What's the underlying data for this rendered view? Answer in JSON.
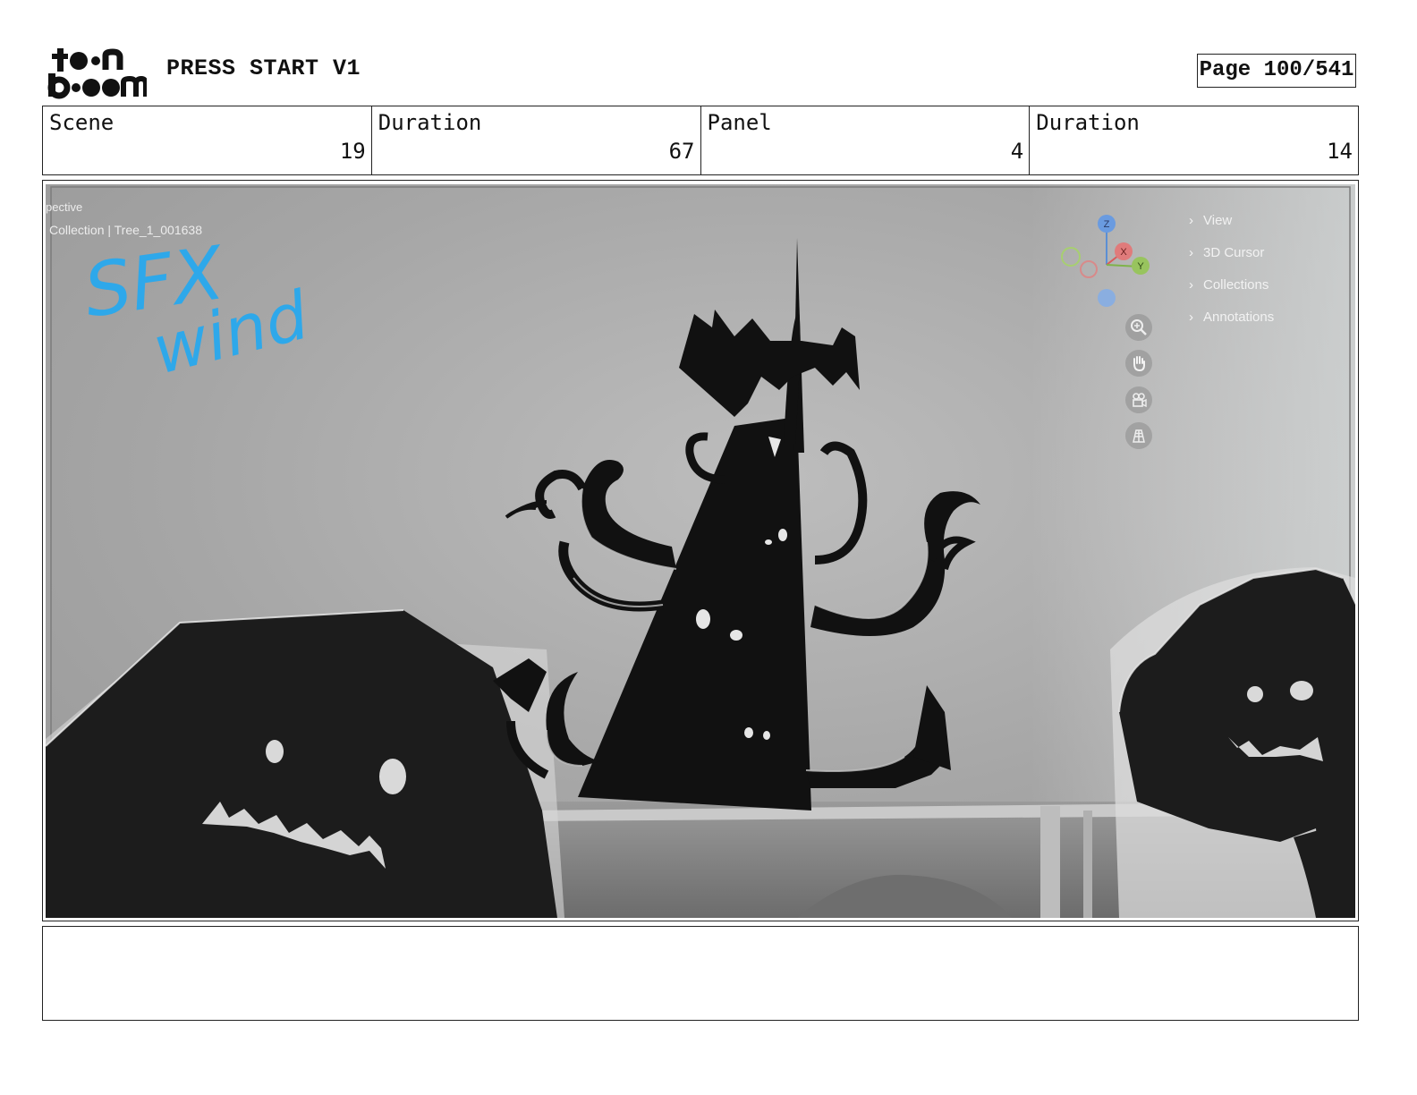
{
  "header": {
    "project_title": "PRESS START V1",
    "page_label": "Page 100/541"
  },
  "info": {
    "scene_label": "Scene",
    "scene_value": "19",
    "scene_duration_label": "Duration",
    "scene_duration_value": "67",
    "panel_label": "Panel",
    "panel_value": "4",
    "panel_duration_label": "Duration",
    "panel_duration_value": "14"
  },
  "viewport": {
    "mode_text": "pective",
    "collection_text": "Collection | Tree_1_001638",
    "annotation_line1": "SFX",
    "annotation_line2": "wind",
    "annotation_color": "#2ea8ea",
    "gizmo_labels": {
      "z": "Z",
      "x": "X",
      "y": "Y"
    },
    "menu_items": [
      "View",
      "3D Cursor",
      "Collections",
      "Annotations"
    ],
    "tools": [
      "zoom-icon",
      "hand-icon",
      "camera-icon",
      "grid-icon"
    ]
  },
  "notes": {
    "text": ""
  }
}
